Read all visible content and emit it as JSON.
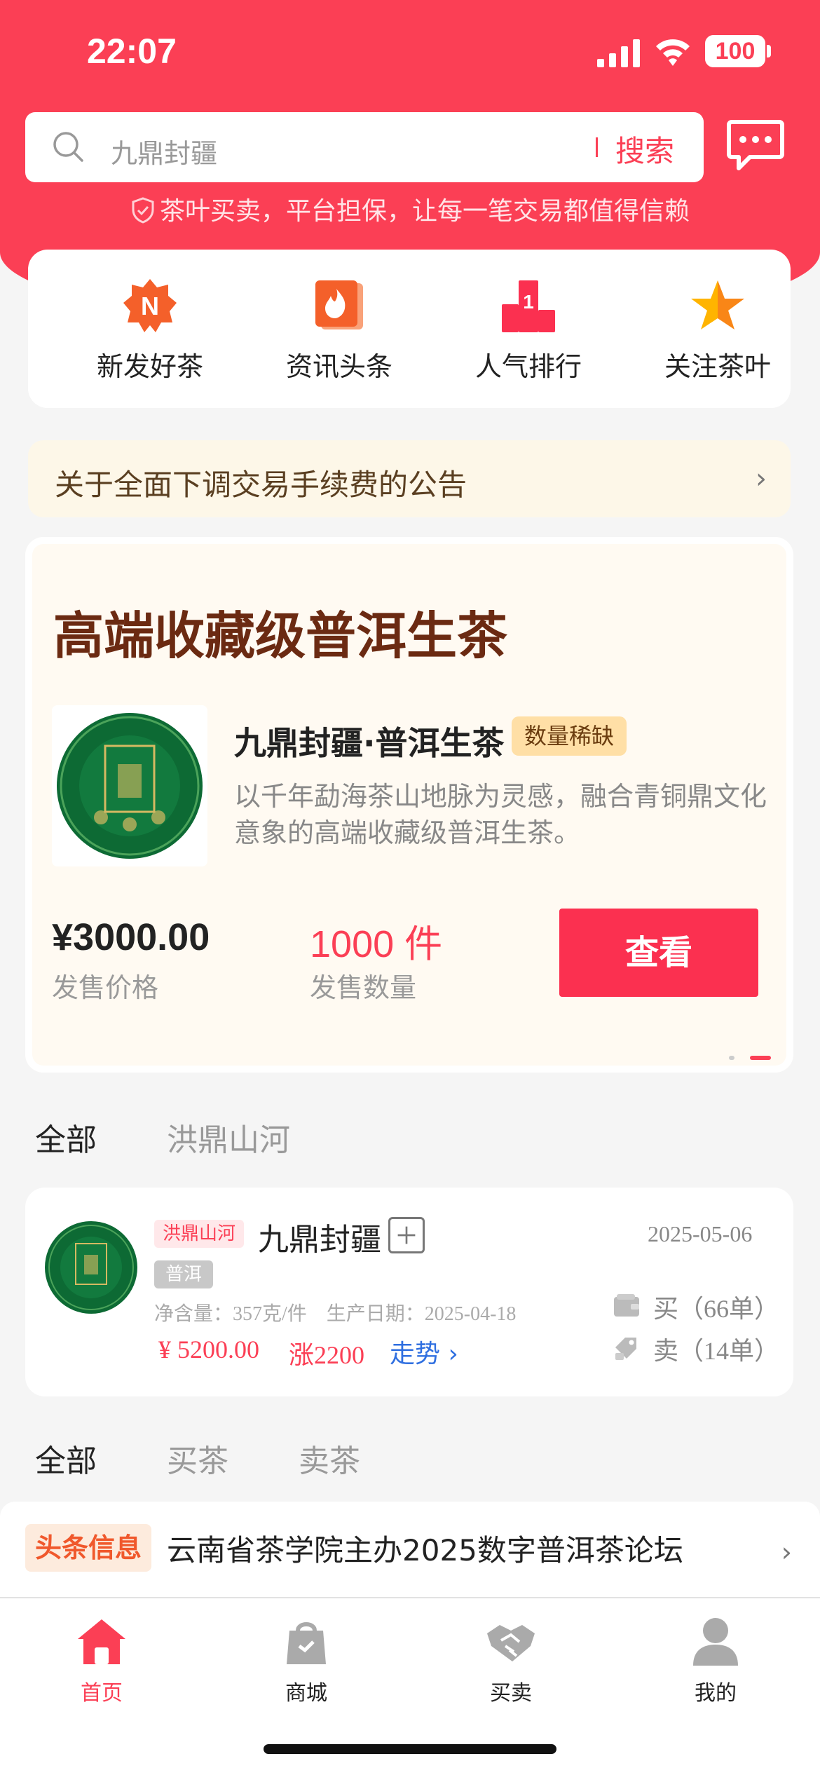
{
  "status_bar": {
    "time": "22:07",
    "battery": "100"
  },
  "search": {
    "placeholder": "九鼎封疆",
    "button": "搜索"
  },
  "slogan": "茶叶买卖，平台担保，让每一笔交易都值得信赖",
  "quick_nav": [
    {
      "label": "新发好茶",
      "icon": "new-badge-icon"
    },
    {
      "label": "资讯头条",
      "icon": "news-flame-icon"
    },
    {
      "label": "人气排行",
      "icon": "podium-rank-icon"
    },
    {
      "label": "关注茶叶",
      "icon": "star-follow-icon"
    }
  ],
  "notice": {
    "text": "关于全面下调交易手续费的公告"
  },
  "banner": {
    "title": "高端收藏级普洱生茶",
    "product_name": "九鼎封疆·普洱生茶",
    "tag": "数量稀缺",
    "description": "以千年勐海茶山地脉为灵感，融合青铜鼎文化意象的高端收藏级普洱生茶。",
    "price": "¥3000.00",
    "price_label": "发售价格",
    "quantity": "1000 件",
    "quantity_label": "发售数量",
    "button": "查看"
  },
  "brand_tabs": [
    "全部",
    "洪鼎山河"
  ],
  "product_row": {
    "brand": "洪鼎山河",
    "name": "九鼎封疆",
    "date": "2025-05-06",
    "type": "普洱",
    "meta": "净含量：357克/件　生产日期：2025-04-18",
    "price": "¥ 5200.00",
    "rise": "涨2200",
    "trend": "走势",
    "buy": "买（66单）",
    "sell": "卖（14单）"
  },
  "trade_tabs": [
    "全部",
    "买茶",
    "卖茶"
  ],
  "news": {
    "tag": "头条信息",
    "text": "云南省茶学院主办2025数字普洱茶论坛"
  },
  "tab_bar": [
    {
      "label": "首页",
      "icon": "home-icon"
    },
    {
      "label": "商城",
      "icon": "shop-bag-icon"
    },
    {
      "label": "买卖",
      "icon": "handshake-icon"
    },
    {
      "label": "我的",
      "icon": "profile-icon"
    }
  ],
  "colors": {
    "brand_red": "#fb3f55",
    "banner_title": "#6b2a12",
    "trend_blue": "#2f6fe0"
  }
}
